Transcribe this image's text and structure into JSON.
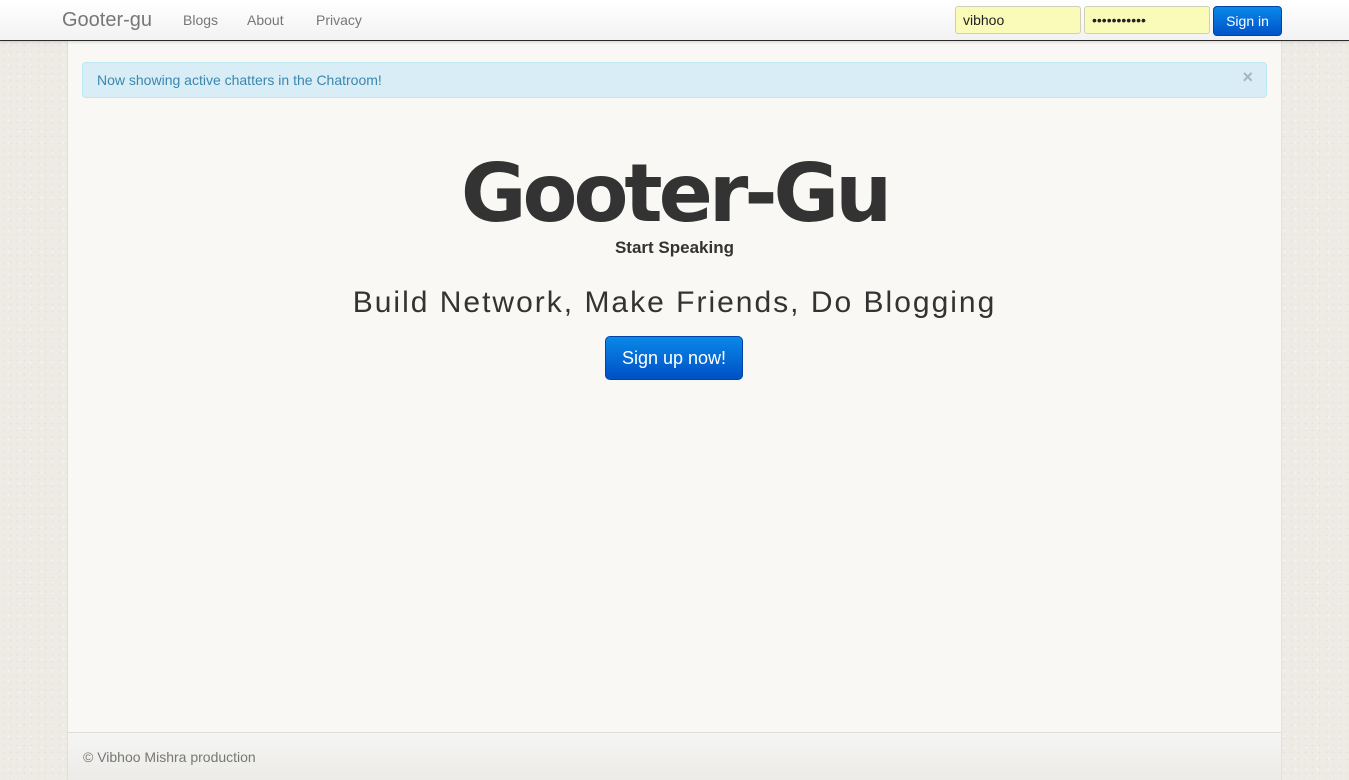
{
  "navbar": {
    "brand": "Gooter-gu",
    "links": [
      "Blogs",
      "About",
      "Privacy"
    ],
    "username_value": "vibhoo",
    "password_value": "•••••••••••",
    "signin_label": "Sign in"
  },
  "alert": {
    "message": "Now showing active chatters in the Chatroom!",
    "close": "×"
  },
  "hero": {
    "title": "Gooter-Gu",
    "subtitle": "Start Speaking",
    "tagline": "Build Network, Make Friends, Do Blogging",
    "cta_label": "Sign up now!"
  },
  "footer": {
    "text": "© Vibhoo Mishra production"
  },
  "colors": {
    "primary_button": "#0a6ad8",
    "alert_bg": "#d9edf7",
    "alert_text": "#3a87ad",
    "autofill_bg": "#fbfbb9"
  }
}
